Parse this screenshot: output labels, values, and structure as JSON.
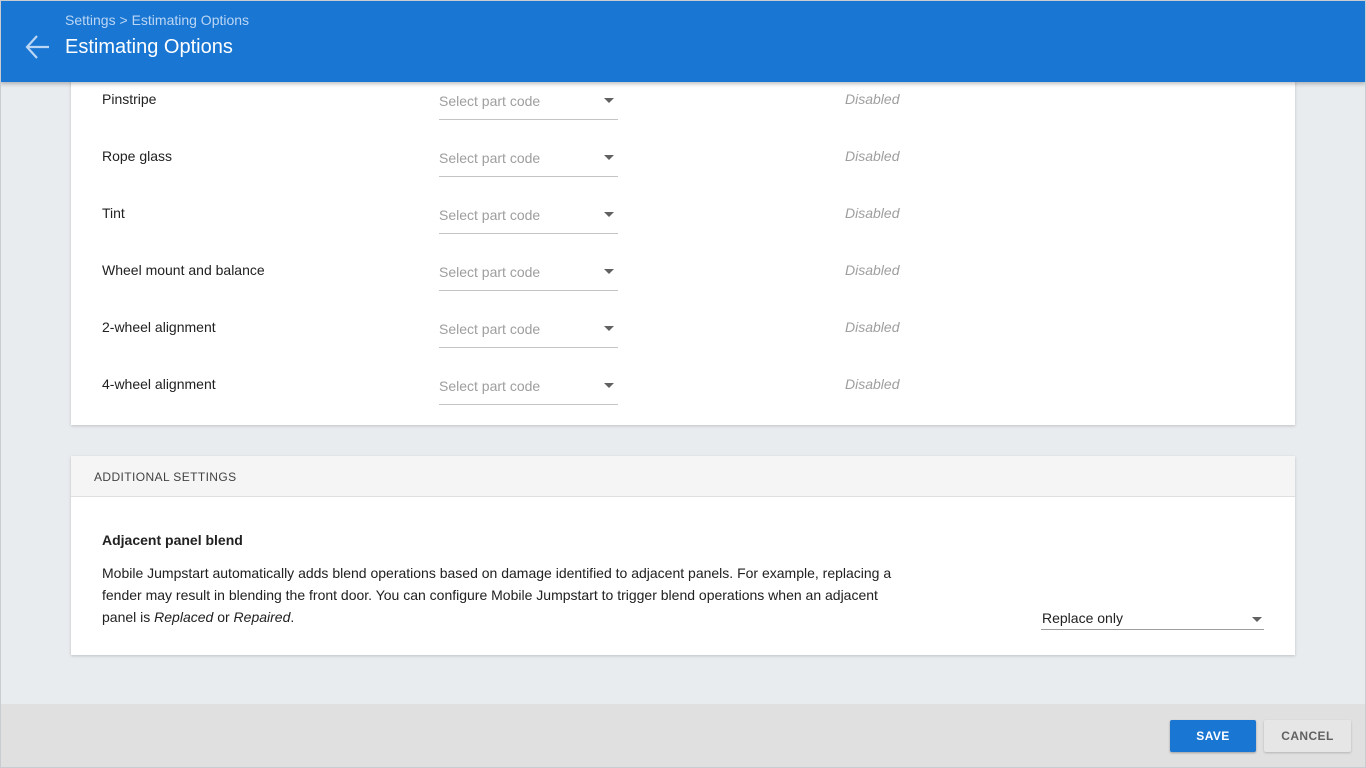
{
  "header": {
    "breadcrumb": {
      "root": "Settings",
      "separator": ">",
      "current": "Estimating Options"
    },
    "title": "Estimating Options",
    "back_icon": "arrow-left-icon"
  },
  "part_codes": {
    "rows": [
      {
        "label": "Pinstripe",
        "placeholder": "Select part code",
        "status": "Disabled"
      },
      {
        "label": "Rope glass",
        "placeholder": "Select part code",
        "status": "Disabled"
      },
      {
        "label": "Tint",
        "placeholder": "Select part code",
        "status": "Disabled"
      },
      {
        "label": "Wheel mount and balance",
        "placeholder": "Select part code",
        "status": "Disabled"
      },
      {
        "label": "2-wheel alignment",
        "placeholder": "Select part code",
        "status": "Disabled"
      },
      {
        "label": "4-wheel alignment",
        "placeholder": "Select part code",
        "status": "Disabled"
      }
    ]
  },
  "additional_settings": {
    "section_title": "ADDITIONAL SETTINGS",
    "adjacent_panel_blend": {
      "title": "Adjacent panel blend",
      "description_part1": "Mobile Jumpstart automatically adds blend operations based on damage identified to adjacent panels. For example, replacing a fender may result in blending the front door. You can configure Mobile Jumpstart to trigger blend operations when an adjacent panel is ",
      "emphasis1": "Replaced",
      "description_part2": " or ",
      "emphasis2": "Repaired",
      "description_part3": ".",
      "selected_value": "Replace only"
    }
  },
  "footer": {
    "save_label": "SAVE",
    "cancel_label": "CANCEL"
  },
  "colors": {
    "primary": "#1976d2",
    "background": "#e9ecef",
    "disabled_text": "#9e9e9e"
  }
}
